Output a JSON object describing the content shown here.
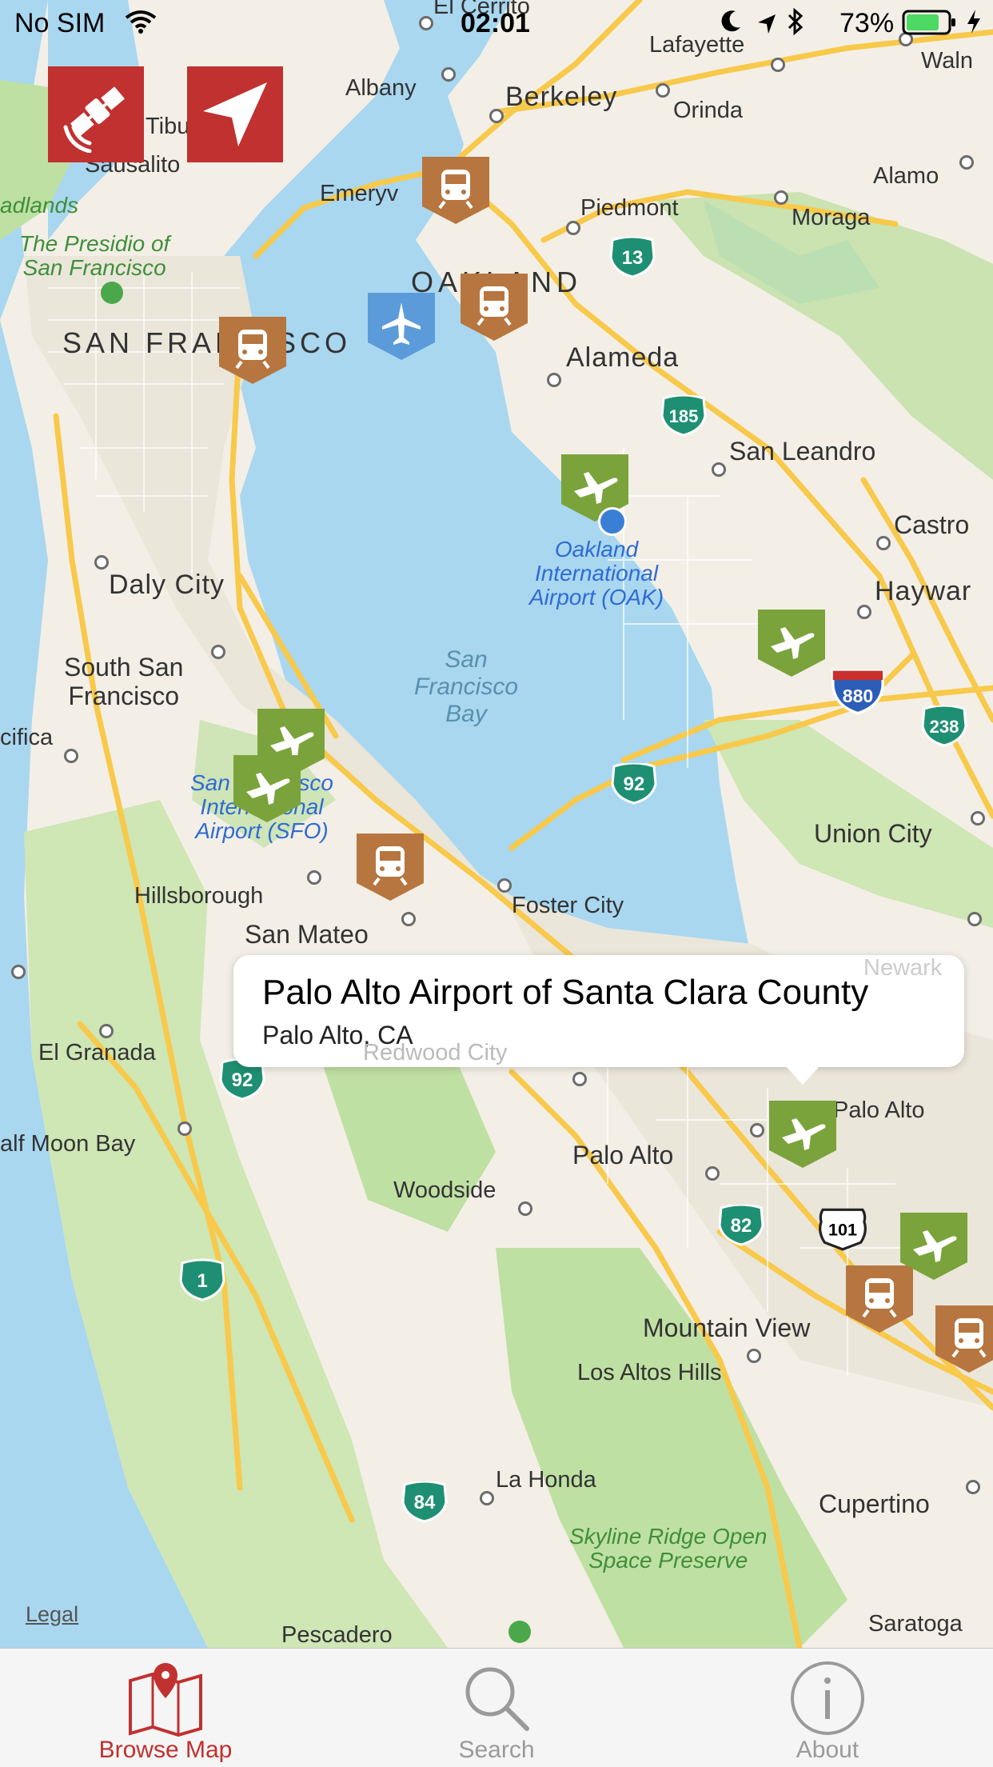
{
  "status_bar": {
    "carrier": "No SIM",
    "time": "02:01",
    "battery": "73%"
  },
  "map": {
    "labels": {
      "el_cerrito": "El Cerrito",
      "albany": "Albany",
      "berkeley": "Berkeley",
      "lafayette": "Lafayette",
      "walnut": "Waln",
      "orinda": "Orinda",
      "tiburon": "Tibu",
      "sausalito": "Sausalito",
      "emeryville": "Emeryv",
      "piedmont": "Piedmont",
      "alamo": "Alamo",
      "moraga": "Moraga",
      "headlands": "adlands",
      "presidio": "The Presidio of\nSan Francisco",
      "oakland": "OAKLAND",
      "san_francisco": "SAN FRANCISCO",
      "alameda": "Alameda",
      "san_leandro": "San Leandro",
      "castro": "Castro",
      "oakland_airport": "Oakland\nInternational\nAirport (OAK)",
      "hayward": "Haywar",
      "daly_city": "Daly City",
      "sf_bay": "San\nFrancisco\nBay",
      "south_sf": "South San\nFrancisco",
      "pacifica": "cifica",
      "sfo": "San Francisco\nInternational\nAirport (SFO)",
      "union_city": "Union City",
      "hillsborough": "Hillsborough",
      "foster_city": "Foster City",
      "san_mateo": "San Mateo",
      "newark": "Newark",
      "el_granada": "El Granada",
      "redwood_city": "Redwood City",
      "east_palo_alto": "Palo Alto",
      "half_moon_bay": "alf Moon Bay",
      "palo_alto": "Palo Alto",
      "woodside": "Woodside",
      "mountain_view": "Mountain View",
      "los_altos_hills": "Los Altos Hills",
      "cupertino": "Cupertino",
      "la_honda": "La Honda",
      "skyline": "Skyline Ridge Open\nSpace Preserve",
      "pescadero": "Pescadero",
      "saratoga": "Saratoga"
    },
    "shields": {
      "r13": "13",
      "r185": "185",
      "i880": "880",
      "r238": "238",
      "r92_bridge": "92",
      "r92_coast": "92",
      "r82": "82",
      "us101": "101",
      "r1": "1",
      "r84": "84"
    },
    "legal": "Legal"
  },
  "controls": {
    "satellite_icon": "satellite-icon",
    "location_icon": "location-arrow-icon"
  },
  "callout": {
    "title": "Palo Alto Airport of Santa Clara County",
    "subtitle": "Palo Alto, CA"
  },
  "tab_bar": {
    "items": [
      {
        "label": "Browse Map",
        "icon": "map-pin-icon",
        "selected": true
      },
      {
        "label": "Search",
        "icon": "search-icon",
        "selected": false
      },
      {
        "label": "About",
        "icon": "info-icon",
        "selected": false
      }
    ],
    "active_color": "#c0312f",
    "inactive_color": "#9a9a9a"
  },
  "colors": {
    "water": "#a9d7f0",
    "land": "#f3efe6",
    "park": "#bfe0a3",
    "road": "#f8c94a",
    "airport_pin": "#7aa33b",
    "rail_pin": "#b7763f",
    "control_red": "#c0312f"
  }
}
